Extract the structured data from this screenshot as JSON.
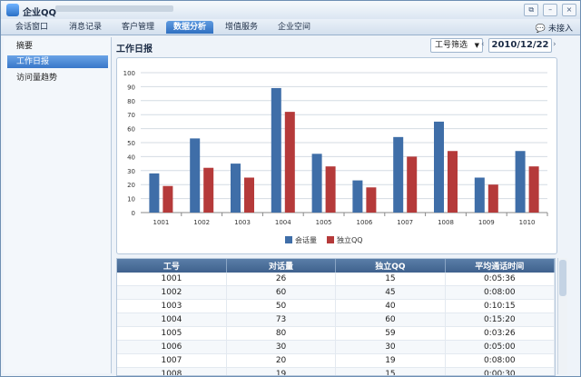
{
  "window": {
    "title": "企业QQ",
    "controls": [
      "⧉",
      "–",
      "×"
    ]
  },
  "tabs": [
    {
      "label": "会话窗口"
    },
    {
      "label": "消息记录"
    },
    {
      "label": "客户管理"
    },
    {
      "label": "数据分析",
      "active": true
    },
    {
      "label": "增值服务"
    },
    {
      "label": "企业空间"
    }
  ],
  "status": {
    "no_access": "未接入"
  },
  "sidebar": {
    "items": [
      {
        "label": "摘要"
      },
      {
        "label": "工作日报",
        "active": true
      },
      {
        "label": "访问量趋势"
      }
    ]
  },
  "header": {
    "title": "工作日报",
    "filter_label": "工号筛选",
    "date": "2010/12/22"
  },
  "chart_data": {
    "type": "bar",
    "categories": [
      "1001",
      "1002",
      "1003",
      "1004",
      "1005",
      "1006",
      "1007",
      "1008",
      "1009",
      "1010"
    ],
    "series": [
      {
        "name": "会话量",
        "values": [
          28,
          53,
          35,
          89,
          42,
          23,
          54,
          65,
          25,
          44
        ],
        "color": "#3f6ea8"
      },
      {
        "name": "独立QQ",
        "values": [
          19,
          32,
          25,
          72,
          33,
          18,
          40,
          44,
          20,
          33
        ],
        "color": "#b53a3a"
      }
    ],
    "ylim": [
      0,
      100
    ],
    "yticks": [
      0,
      10,
      20,
      30,
      40,
      50,
      60,
      70,
      80,
      90,
      100
    ],
    "grid": true,
    "legend_position": "bottom"
  },
  "table": {
    "columns": [
      "工号",
      "对话量",
      "独立QQ",
      "平均通话时间"
    ],
    "rows": [
      [
        "1001",
        "26",
        "15",
        "0:05:36"
      ],
      [
        "1002",
        "60",
        "45",
        "0:08:00"
      ],
      [
        "1003",
        "50",
        "40",
        "0:10:15"
      ],
      [
        "1004",
        "73",
        "60",
        "0:15:20"
      ],
      [
        "1005",
        "80",
        "59",
        "0:03:26"
      ],
      [
        "1006",
        "30",
        "30",
        "0:05:00"
      ],
      [
        "1007",
        "20",
        "19",
        "0:08:00"
      ],
      [
        "1008",
        "19",
        "15",
        "0:00:30"
      ]
    ]
  }
}
